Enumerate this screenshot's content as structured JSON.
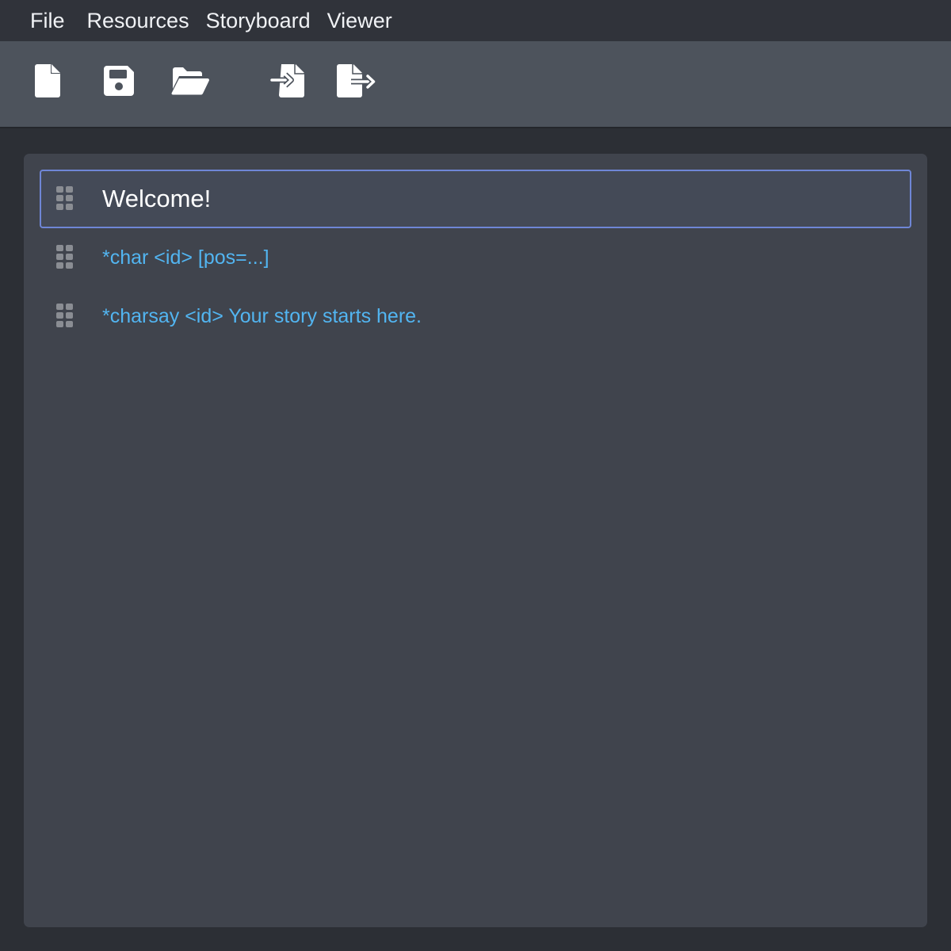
{
  "menubar": {
    "items": [
      {
        "label": "File"
      },
      {
        "label": "Resources"
      },
      {
        "label": "Storyboard"
      },
      {
        "label": "Viewer"
      }
    ]
  },
  "toolbar": {
    "buttons": [
      {
        "icon": "new-file-icon"
      },
      {
        "icon": "save-icon"
      },
      {
        "icon": "open-folder-icon"
      },
      {
        "icon": "import-file-icon"
      },
      {
        "icon": "export-file-icon"
      }
    ]
  },
  "editor": {
    "lines": [
      {
        "text": "Welcome!",
        "kind": "title",
        "selected": true
      },
      {
        "text": "*char <id> [pos=...]",
        "kind": "command",
        "selected": false
      },
      {
        "text": "*charsay <id> Your story starts here.",
        "kind": "command",
        "selected": false
      }
    ]
  },
  "colors": {
    "accent_border": "#6f86d6",
    "command_text": "#52b5f1",
    "toolbar_bg": "#4d535c",
    "editor_bg": "#40444d"
  }
}
